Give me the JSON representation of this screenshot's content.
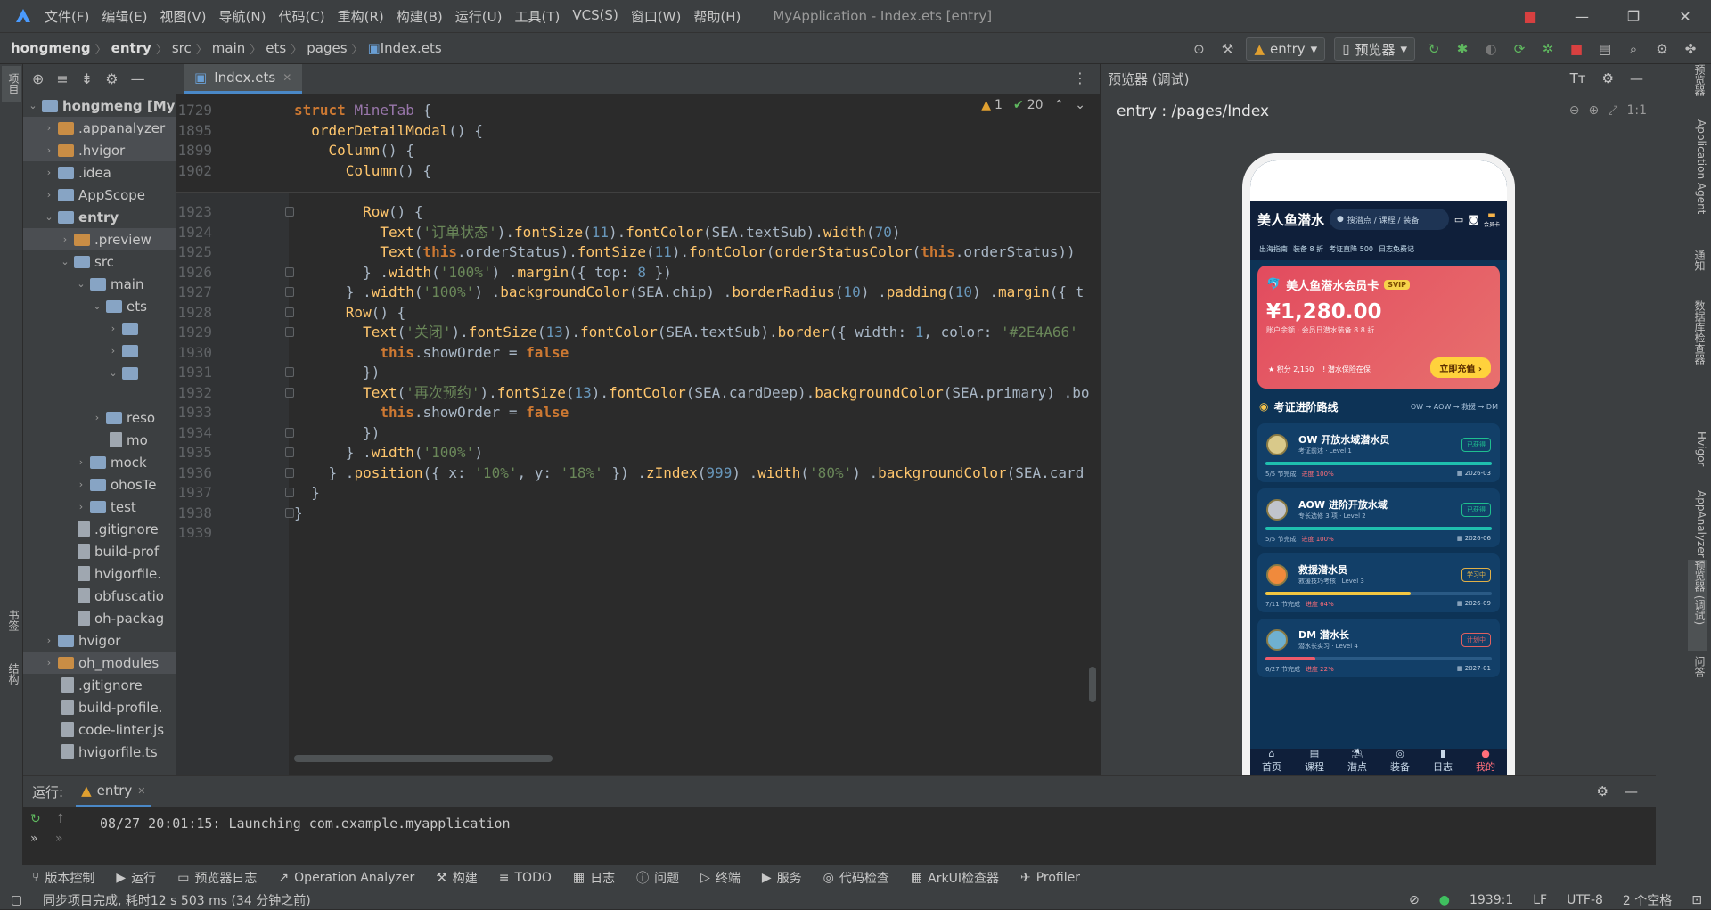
{
  "window": {
    "menus": [
      "文件(F)",
      "编辑(E)",
      "视图(V)",
      "导航(N)",
      "代码(C)",
      "重构(R)",
      "构建(B)",
      "运行(U)",
      "工具(T)",
      "VCS(S)",
      "窗口(W)",
      "帮助(H)"
    ],
    "title": "MyApplication - Index.ets [entry]"
  },
  "breadcrumb": [
    "hongmeng",
    "entry",
    "src",
    "main",
    "ets",
    "pages",
    "Index.ets"
  ],
  "toolbar": {
    "module": "entry",
    "device": "预览器"
  },
  "left_tabs": {
    "project": "项目",
    "bookmarks": "书签",
    "structure": "结构"
  },
  "project_tree": [
    {
      "label": "hongmeng [My",
      "bold": true,
      "indent": 0,
      "arrow": "v",
      "icon": "folder-b"
    },
    {
      "label": ".appanalyzer",
      "indent": 1,
      "arrow": ">",
      "icon": "folder-o",
      "sel": true
    },
    {
      "label": ".hvigor",
      "indent": 1,
      "arrow": ">",
      "icon": "folder-o",
      "sel": true
    },
    {
      "label": ".idea",
      "indent": 1,
      "arrow": ">",
      "icon": "folder-b"
    },
    {
      "label": "AppScope",
      "indent": 1,
      "arrow": ">",
      "icon": "folder-b"
    },
    {
      "label": "entry",
      "indent": 1,
      "arrow": "v",
      "icon": "folder-b",
      "bold": true
    },
    {
      "label": ".preview",
      "indent": 2,
      "arrow": ">",
      "icon": "folder-o",
      "sel": true
    },
    {
      "label": "src",
      "indent": 2,
      "arrow": "v",
      "icon": "folder-b"
    },
    {
      "label": "main",
      "indent": 3,
      "arrow": "v",
      "icon": "folder-b"
    },
    {
      "label": "ets",
      "indent": 4,
      "arrow": "v",
      "icon": "folder-b"
    },
    {
      "label": "",
      "indent": 5,
      "arrow": ">",
      "icon": "folder-b"
    },
    {
      "label": "",
      "indent": 5,
      "arrow": ">",
      "icon": "folder-b"
    },
    {
      "label": "",
      "indent": 5,
      "arrow": "v",
      "icon": "folder-b"
    },
    {
      "label": "",
      "indent": 6,
      "arrow": "",
      "icon": ""
    },
    {
      "label": "reso",
      "indent": 4,
      "arrow": ">",
      "icon": "folder-b"
    },
    {
      "label": "mo",
      "indent": 4,
      "arrow": "",
      "icon": "file"
    },
    {
      "label": "mock",
      "indent": 3,
      "arrow": ">",
      "icon": "folder-b"
    },
    {
      "label": "ohosTe",
      "indent": 3,
      "arrow": ">",
      "icon": "folder-b"
    },
    {
      "label": "test",
      "indent": 3,
      "arrow": ">",
      "icon": "folder-b"
    },
    {
      "label": ".gitignore",
      "indent": 2,
      "arrow": "",
      "icon": "file"
    },
    {
      "label": "build-prof",
      "indent": 2,
      "arrow": "",
      "icon": "file"
    },
    {
      "label": "hvigorfile.",
      "indent": 2,
      "arrow": "",
      "icon": "file"
    },
    {
      "label": "obfuscatio",
      "indent": 2,
      "arrow": "",
      "icon": "file"
    },
    {
      "label": "oh-packag",
      "indent": 2,
      "arrow": "",
      "icon": "file"
    },
    {
      "label": "hvigor",
      "indent": 1,
      "arrow": ">",
      "icon": "folder-b"
    },
    {
      "label": "oh_modules",
      "indent": 1,
      "arrow": ">",
      "icon": "folder-o",
      "sel": true
    },
    {
      "label": ".gitignore",
      "indent": 1,
      "arrow": "",
      "icon": "file"
    },
    {
      "label": "build-profile.",
      "indent": 1,
      "arrow": "",
      "icon": "file"
    },
    {
      "label": "code-linter.js",
      "indent": 1,
      "arrow": "",
      "icon": "file"
    },
    {
      "label": "hvigorfile.ts",
      "indent": 1,
      "arrow": "",
      "icon": "file"
    }
  ],
  "editor": {
    "tab": "Index.ets",
    "inspections": {
      "warnings": "1",
      "weak": "20"
    },
    "sticky_lines": [
      {
        "n": "1729",
        "segs": [
          [
            "kw",
            "struct "
          ],
          [
            "prop",
            "MineTab"
          ],
          [
            "cls",
            " {"
          ]
        ]
      },
      {
        "n": "1895",
        "segs": [
          [
            "cls",
            "  "
          ],
          [
            "fn",
            "orderDetailModal"
          ],
          [
            "cls",
            "() {"
          ]
        ]
      },
      {
        "n": "1899",
        "segs": [
          [
            "cls",
            "    "
          ],
          [
            "fn",
            "Column"
          ],
          [
            "cls",
            "() {"
          ]
        ]
      },
      {
        "n": "1902",
        "segs": [
          [
            "cls",
            "      "
          ],
          [
            "fn",
            "Column"
          ],
          [
            "cls",
            "() {"
          ]
        ]
      }
    ],
    "lines": [
      {
        "n": "1923",
        "segs": [
          [
            "cls",
            "        "
          ],
          [
            "fn",
            "Row"
          ],
          [
            "cls",
            "() {"
          ]
        ]
      },
      {
        "n": "1924",
        "segs": [
          [
            "cls",
            "          "
          ],
          [
            "fn",
            "Text"
          ],
          [
            "cls",
            "("
          ],
          [
            "str",
            "'订单状态'"
          ],
          [
            "cls",
            ")."
          ],
          [
            "fn",
            "fontSize"
          ],
          [
            "cls",
            "("
          ],
          [
            "num",
            "11"
          ],
          [
            "cls",
            ")."
          ],
          [
            "fn",
            "fontColor"
          ],
          [
            "cls",
            "(SEA.textSub)."
          ],
          [
            "fn",
            "width"
          ],
          [
            "cls",
            "("
          ],
          [
            "num",
            "70"
          ],
          [
            "cls",
            ")"
          ]
        ]
      },
      {
        "n": "1925",
        "segs": [
          [
            "cls",
            "          "
          ],
          [
            "fn",
            "Text"
          ],
          [
            "cls",
            "("
          ],
          [
            "kw",
            "this"
          ],
          [
            "cls",
            ".orderStatus)."
          ],
          [
            "fn",
            "fontSize"
          ],
          [
            "cls",
            "("
          ],
          [
            "num",
            "11"
          ],
          [
            "cls",
            ")."
          ],
          [
            "fn",
            "fontColor"
          ],
          [
            "cls",
            "("
          ],
          [
            "fn",
            "orderStatusColor"
          ],
          [
            "cls",
            "("
          ],
          [
            "kw",
            "this"
          ],
          [
            "cls",
            ".orderStatus))"
          ]
        ]
      },
      {
        "n": "1926",
        "segs": [
          [
            "cls",
            "        } ."
          ],
          [
            "fn",
            "width"
          ],
          [
            "cls",
            "("
          ],
          [
            "str",
            "'100%'"
          ],
          [
            "cls",
            ") ."
          ],
          [
            "fn",
            "margin"
          ],
          [
            "cls",
            "({ top: "
          ],
          [
            "num",
            "8"
          ],
          [
            "cls",
            " })"
          ]
        ]
      },
      {
        "n": "1927",
        "segs": [
          [
            "cls",
            "      } ."
          ],
          [
            "fn",
            "width"
          ],
          [
            "cls",
            "("
          ],
          [
            "str",
            "'100%'"
          ],
          [
            "cls",
            ") ."
          ],
          [
            "fn",
            "backgroundColor"
          ],
          [
            "cls",
            "(SEA.chip) ."
          ],
          [
            "fn",
            "borderRadius"
          ],
          [
            "cls",
            "("
          ],
          [
            "num",
            "10"
          ],
          [
            "cls",
            ") ."
          ],
          [
            "fn",
            "padding"
          ],
          [
            "cls",
            "("
          ],
          [
            "num",
            "10"
          ],
          [
            "cls",
            ") ."
          ],
          [
            "fn",
            "margin"
          ],
          [
            "cls",
            "({ t"
          ]
        ]
      },
      {
        "n": "1928",
        "segs": [
          [
            "cls",
            "      "
          ],
          [
            "fn",
            "Row"
          ],
          [
            "cls",
            "() {"
          ]
        ]
      },
      {
        "n": "1929",
        "segs": [
          [
            "cls",
            "        "
          ],
          [
            "fn",
            "Text"
          ],
          [
            "cls",
            "("
          ],
          [
            "str",
            "'关闭'"
          ],
          [
            "cls",
            ")."
          ],
          [
            "fn",
            "fontSize"
          ],
          [
            "cls",
            "("
          ],
          [
            "num",
            "13"
          ],
          [
            "cls",
            ")."
          ],
          [
            "fn",
            "fontColor"
          ],
          [
            "cls",
            "(SEA.textSub)."
          ],
          [
            "fn",
            "border"
          ],
          [
            "cls",
            "({ width: "
          ],
          [
            "num",
            "1"
          ],
          [
            "cls",
            ", color: "
          ],
          [
            "str",
            "'#2E4A66'"
          ]
        ]
      },
      {
        "n": "1930",
        "segs": [
          [
            "cls",
            "          "
          ],
          [
            "kw",
            "this"
          ],
          [
            "cls",
            ".showOrder = "
          ],
          [
            "kw",
            "false"
          ]
        ]
      },
      {
        "n": "1931",
        "segs": [
          [
            "cls",
            "        })"
          ]
        ]
      },
      {
        "n": "1932",
        "segs": [
          [
            "cls",
            "        "
          ],
          [
            "fn",
            "Text"
          ],
          [
            "cls",
            "("
          ],
          [
            "str",
            "'再次预约'"
          ],
          [
            "cls",
            ")."
          ],
          [
            "fn",
            "fontSize"
          ],
          [
            "cls",
            "("
          ],
          [
            "num",
            "13"
          ],
          [
            "cls",
            ")."
          ],
          [
            "fn",
            "fontColor"
          ],
          [
            "cls",
            "(SEA.cardDeep)."
          ],
          [
            "fn",
            "backgroundColor"
          ],
          [
            "cls",
            "(SEA.primary) .bo"
          ]
        ]
      },
      {
        "n": "1933",
        "segs": [
          [
            "cls",
            "          "
          ],
          [
            "kw",
            "this"
          ],
          [
            "cls",
            ".showOrder = "
          ],
          [
            "kw",
            "false"
          ]
        ]
      },
      {
        "n": "1934",
        "segs": [
          [
            "cls",
            "        })"
          ]
        ]
      },
      {
        "n": "1935",
        "segs": [
          [
            "cls",
            "      } ."
          ],
          [
            "fn",
            "width"
          ],
          [
            "cls",
            "("
          ],
          [
            "str",
            "'100%'"
          ],
          [
            "cls",
            ")"
          ]
        ]
      },
      {
        "n": "1936",
        "segs": [
          [
            "cls",
            "    } ."
          ],
          [
            "fn",
            "position"
          ],
          [
            "cls",
            "({ x: "
          ],
          [
            "str",
            "'10%'"
          ],
          [
            "cls",
            ", y: "
          ],
          [
            "str",
            "'18%'"
          ],
          [
            "cls",
            " }) ."
          ],
          [
            "fn",
            "zIndex"
          ],
          [
            "cls",
            "("
          ],
          [
            "num",
            "999"
          ],
          [
            "cls",
            ") ."
          ],
          [
            "fn",
            "width"
          ],
          [
            "cls",
            "("
          ],
          [
            "str",
            "'80%'"
          ],
          [
            "cls",
            ") ."
          ],
          [
            "fn",
            "backgroundColor"
          ],
          [
            "cls",
            "(SEA.card"
          ]
        ]
      },
      {
        "n": "1937",
        "segs": [
          [
            "cls",
            "  }"
          ]
        ]
      },
      {
        "n": "1938",
        "segs": [
          [
            "cls",
            "}"
          ]
        ]
      },
      {
        "n": "1939",
        "segs": []
      }
    ]
  },
  "preview": {
    "panel_title": "预览器 (调试)",
    "route": "entry : /pages/Index",
    "app": {
      "brand": "美人鱼潜水",
      "search": "搜潜点 / 课程 / 装备",
      "member_label": "会员卡",
      "tags": [
        "出海指南",
        "装备 8 折",
        "考证直降 500",
        "日志免费记"
      ],
      "card": {
        "title": "美人鱼潜水会员卡",
        "tier": "SVIP",
        "amount": "¥1,280.00",
        "sub": "账户余额 · 会员日潜水装备 8.8 折",
        "points": "积分 2,150",
        "insurance": "潜水保险在保",
        "button": "立即充值 ›"
      },
      "section": {
        "title": "考证进阶路线",
        "path": "OW → AOW → 救援 → DM"
      },
      "levels": [
        {
          "name": "OW 开放水域潜水员",
          "desc": "考证前述 · Level 1",
          "status": "已获得",
          "status_color": "#1fbf8f",
          "progress": "5/5 节完成",
          "pct": "进度 100%",
          "ratio": 1.0,
          "bar_color": "#1fbfae",
          "date": "2026-03",
          "badge": "#d9c98a"
        },
        {
          "name": "AOW 进阶开放水域",
          "desc": "专长选修 3 项 · Level 2",
          "status": "已获得",
          "status_color": "#1fbf8f",
          "progress": "5/5 节完成",
          "pct": "进度 100%",
          "ratio": 1.0,
          "bar_color": "#1fbfae",
          "date": "2026-06",
          "badge": "#c0c4cc"
        },
        {
          "name": "救援潜水员",
          "desc": "救援技巧考核 · Level 3",
          "status": "学习中",
          "status_color": "#e0b048",
          "progress": "7/11 节完成",
          "pct": "进度 64%",
          "ratio": 0.64,
          "bar_color": "#f2c641",
          "date": "2026-09",
          "badge": "#f08a3c"
        },
        {
          "name": "DM 潜水长",
          "desc": "潜水长实习 · Level 4",
          "status": "计划中",
          "status_color": "#e06060",
          "progress": "6/27 节完成",
          "pct": "进度 22%",
          "ratio": 0.22,
          "bar_color": "#ee5a6a",
          "date": "2027-01",
          "badge": "#6fb0d0"
        }
      ],
      "nav": [
        "首页",
        "课程",
        "潜点",
        "装备",
        "日志",
        "我的"
      ]
    }
  },
  "right_tabs": [
    "预览器",
    "Application Agent",
    "通知",
    "数据库检查器",
    "Hvigor",
    "AppAnalyzer",
    "预览器 (调试)",
    "问答"
  ],
  "run": {
    "label": "运行:",
    "tab": "entry",
    "log": "08/27 20:01:15: Launching com.example.myapplication"
  },
  "tool_windows": [
    "版本控制",
    "运行",
    "预览器日志",
    "Operation Analyzer",
    "构建",
    "TODO",
    "日志",
    "问题",
    "终端",
    "服务",
    "代码检查",
    "ArkUI检查器",
    "Profiler"
  ],
  "status": {
    "message": "同步项目完成, 耗时12 s 503 ms (34 分钟之前)",
    "position": "1939:1",
    "line_sep": "LF",
    "encoding": "UTF-8",
    "indent": "2 个空格"
  }
}
